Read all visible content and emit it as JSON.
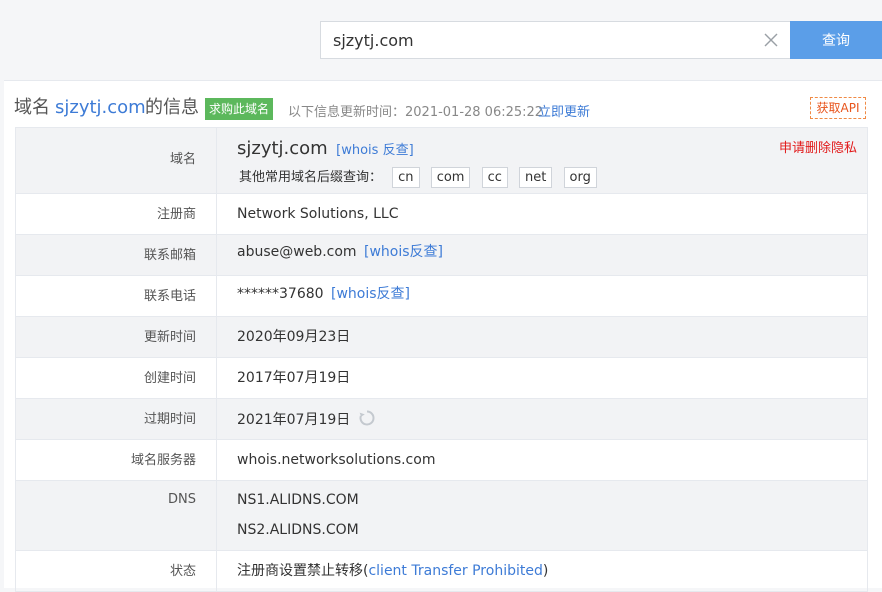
{
  "search": {
    "value": "sjzytj.com",
    "button_label": "查询"
  },
  "title": {
    "prefix": "域名",
    "domain": "sjzytj.com",
    "suffix": "的信息",
    "buy_badge": "求购此域名",
    "update_label": "以下信息更新时间：2021-01-28 06:25:22",
    "update_link": "立即更新",
    "api_button": "获取API"
  },
  "rows": {
    "domain": {
      "label": "域名",
      "value": "sjzytj.com",
      "whois_link": "[whois 反查]",
      "remove_privacy": "申请删除隐私",
      "suffix_label": "其他常用域名后缀查询：",
      "suffixes": [
        "cn",
        "com",
        "cc",
        "net",
        "org"
      ]
    },
    "registrar": {
      "label": "注册商",
      "value": "Network Solutions, LLC"
    },
    "email": {
      "label": "联系邮箱",
      "value": "abuse@web.com",
      "link": "[whois反查]"
    },
    "phone": {
      "label": "联系电话",
      "value": "******37680",
      "link": "[whois反查]"
    },
    "updated": {
      "label": "更新时间",
      "value": "2020年09月23日"
    },
    "created": {
      "label": "创建时间",
      "value": "2017年07月19日"
    },
    "expires": {
      "label": "过期时间",
      "value": "2021年07月19日"
    },
    "whois_server": {
      "label": "域名服务器",
      "value": "whois.networksolutions.com"
    },
    "dns": {
      "label": "DNS",
      "values": [
        "NS1.ALIDNS.COM",
        "NS2.ALIDNS.COM"
      ]
    },
    "status": {
      "label": "状态",
      "value_prefix": "注册商设置禁止转移(",
      "value_link": "client Transfer Prohibited",
      "value_suffix": ")"
    }
  },
  "colors": {
    "accent": "#5b9ee8",
    "link": "#3d7bd6",
    "badge": "#5cb85c",
    "alert": "#e21b1b",
    "api": "#e8541c"
  }
}
